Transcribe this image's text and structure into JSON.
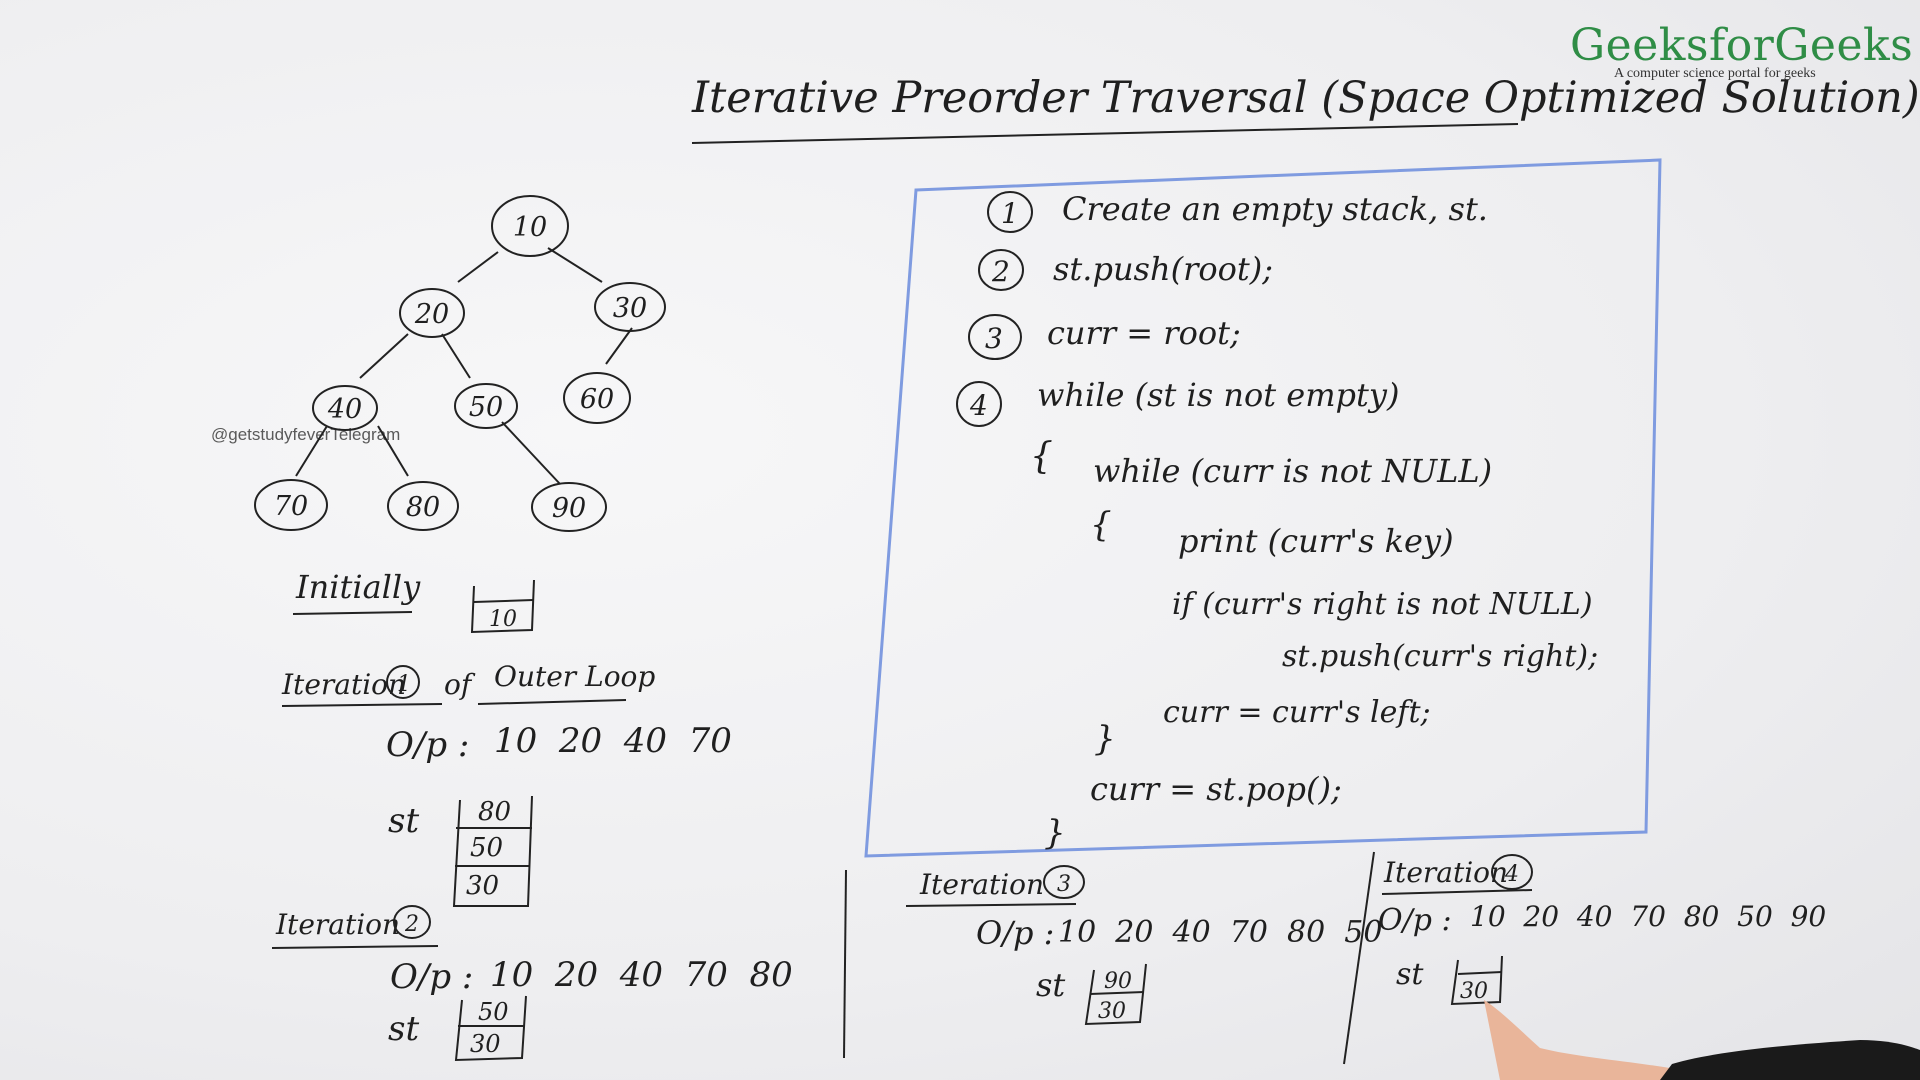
{
  "brand": {
    "name": "GeeksforGeeks",
    "tagline": "A computer science portal for geeks"
  },
  "watermark": "@getstudyfeverTelegram",
  "title": "Iterative Preorder Traversal (Space Optimized Solution)",
  "tree": {
    "nodes": [
      "10",
      "20",
      "30",
      "40",
      "50",
      "60",
      "70",
      "80",
      "90"
    ]
  },
  "algorithm": {
    "step1": "Create an empty stack, st.",
    "step2": "st.push(root);",
    "step3": "curr = root;",
    "step4": "while (st is not empty)",
    "open_outer": "{",
    "inner_while": "while (curr is not NULL)",
    "open_inner": "{",
    "print_line": "print (curr's key)",
    "if_line": "if (curr's right is not NULL)",
    "push_right": "st.push(curr's right);",
    "curr_left": "curr = curr's left;",
    "close_inner": "}",
    "pop_line": "curr = st.pop();",
    "close_outer": "}",
    "step_numbers": [
      "1",
      "2",
      "3",
      "4"
    ]
  },
  "initially": {
    "label": "Initially",
    "stack": [
      "10"
    ]
  },
  "iteration1": {
    "label": "Iteration",
    "num": "1",
    "suffix_of": "of",
    "suffix_loop": "Outer Loop",
    "op_label": "O/p :",
    "output": "10  20  40  70",
    "st_label": "st",
    "stack": [
      "80",
      "50",
      "30"
    ]
  },
  "iteration2": {
    "label": "Iteration",
    "num": "2",
    "op_label": "O/p :",
    "output": "10  20  40  70  80",
    "st_label": "st",
    "stack": [
      "50",
      "30"
    ]
  },
  "iteration3": {
    "label": "Iteration",
    "num": "3",
    "op_label": "O/p :",
    "output": "10  20  40  70  80  50",
    "st_label": "st",
    "stack": [
      "90",
      "30"
    ]
  },
  "iteration4": {
    "label": "Iteration",
    "num": "4",
    "op_label": "O/p :",
    "output": "10  20  40  70  80  50  90",
    "st_label": "st",
    "stack": [
      "30"
    ]
  }
}
